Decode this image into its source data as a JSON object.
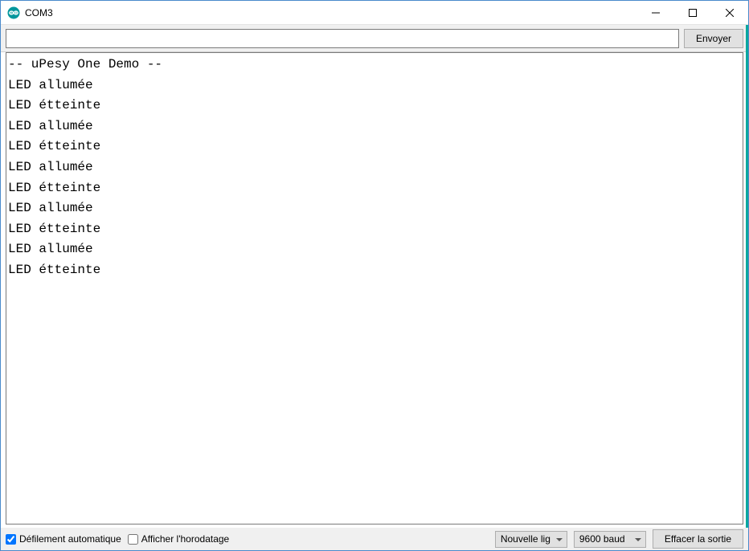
{
  "titlebar": {
    "title": "COM3"
  },
  "toolbar": {
    "input_value": "",
    "send_label": "Envoyer"
  },
  "console": {
    "lines": [
      "-- uPesy One Demo --",
      "LED allumée",
      "LED étteinte",
      "LED allumée",
      "LED étteinte",
      "LED allumée",
      "LED étteinte",
      "LED allumée",
      "LED étteinte",
      "LED allumée",
      "LED étteinte"
    ]
  },
  "bottombar": {
    "autoscroll_label": "Défilement automatique",
    "autoscroll_checked": true,
    "timestamp_label": "Afficher l'horodatage",
    "timestamp_checked": false,
    "line_ending_selected": "Nouvelle ligne",
    "baud_selected": "9600 baud",
    "clear_label": "Effacer la sortie"
  }
}
